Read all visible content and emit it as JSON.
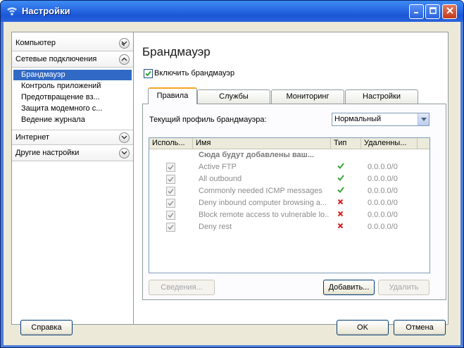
{
  "window": {
    "title": "Настройки"
  },
  "nav": {
    "categories": [
      {
        "label": "Компьютер"
      },
      {
        "label": "Сетевые подключения"
      },
      {
        "label": "Интернет"
      },
      {
        "label": "Другие настройки"
      }
    ],
    "items": [
      {
        "label": "Брандмауэр",
        "selected": true
      },
      {
        "label": "Контроль приложений"
      },
      {
        "label": "Предотвращение вз..."
      },
      {
        "label": "Защита модемного с..."
      },
      {
        "label": "Ведение журнала"
      }
    ]
  },
  "content": {
    "title": "Брандмауэр",
    "enable_label": "Включить брандмауэр",
    "tabs": [
      {
        "label": "Правила"
      },
      {
        "label": "Службы"
      },
      {
        "label": "Мониторинг"
      },
      {
        "label": "Настройки"
      }
    ],
    "profile_label": "Текущий профиль брандмауэра:",
    "profile_value": "Нормальный",
    "columns": [
      "Исполь...",
      "Имя",
      "Тип",
      "Удаленны..."
    ],
    "group_label": "Сюда будут добавлены ваш...",
    "rules": [
      {
        "name": "Active FTP",
        "type": "allow",
        "remote": "0.0.0.0/0"
      },
      {
        "name": "All outbound",
        "type": "allow",
        "remote": "0.0.0.0/0"
      },
      {
        "name": "Commonly needed ICMP messages",
        "type": "allow",
        "remote": "0.0.0.0/0"
      },
      {
        "name": "Deny inbound computer browsing a...",
        "type": "deny",
        "remote": "0.0.0.0/0"
      },
      {
        "name": "Block remote access to vulnerable lo...",
        "type": "deny",
        "remote": "0.0.0.0/0"
      },
      {
        "name": "Deny rest",
        "type": "deny",
        "remote": "0.0.0.0/0"
      }
    ],
    "buttons": {
      "details": "Сведения...",
      "add": "Добавить...",
      "remove": "Удалить"
    }
  },
  "footer": {
    "help": "Справка",
    "ok": "OK",
    "cancel": "Отмена"
  },
  "colors": {
    "allow": "#3aa63a",
    "deny": "#d42020",
    "selection": "#316ac5"
  }
}
